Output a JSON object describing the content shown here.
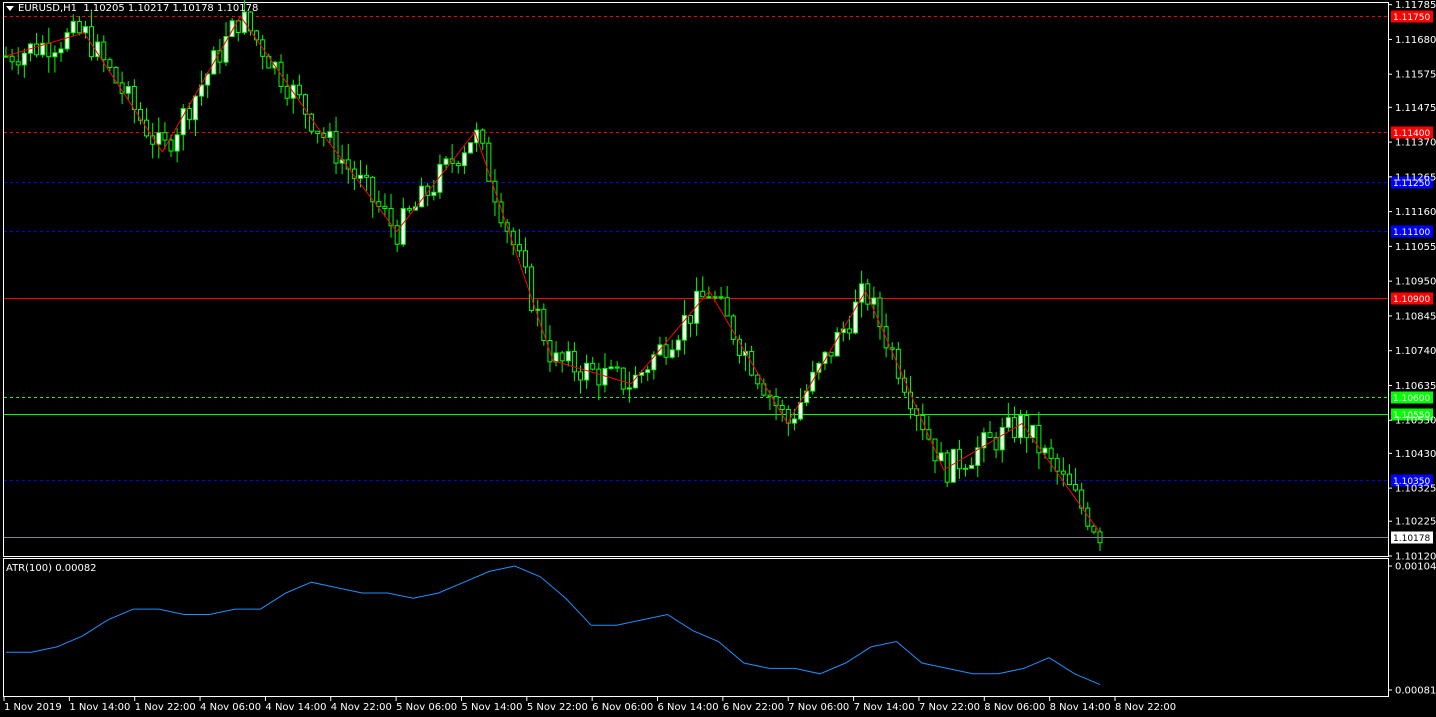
{
  "header": {
    "symbol": "EURUSD,H1",
    "ohlc": "1.10205 1.10217 1.10178 1.10178"
  },
  "atr": {
    "label": "ATR(100) 0.00082"
  },
  "price_axis": {
    "ticks": [
      "1.11785",
      "1.11680",
      "1.11575",
      "1.11475",
      "1.11370",
      "1.11265",
      "1.11160",
      "1.11055",
      "1.10950",
      "1.10845",
      "1.10740",
      "1.10635",
      "1.10530",
      "1.10430",
      "1.10325",
      "1.10225",
      "1.10120"
    ],
    "current_price": "1.10178"
  },
  "atr_axis": {
    "ticks": [
      "0.00104",
      "0.00081"
    ]
  },
  "time_axis": {
    "labels": [
      "1 Nov 2019",
      "1 Nov 14:00",
      "1 Nov 22:00",
      "4 Nov 06:00",
      "4 Nov 14:00",
      "4 Nov 22:00",
      "5 Nov 06:00",
      "5 Nov 14:00",
      "5 Nov 22:00",
      "6 Nov 06:00",
      "6 Nov 14:00",
      "6 Nov 22:00",
      "7 Nov 06:00",
      "7 Nov 14:00",
      "7 Nov 22:00",
      "8 Nov 06:00",
      "8 Nov 14:00",
      "8 Nov 22:00"
    ]
  },
  "levels": [
    {
      "price": 1.1175,
      "label": "1.11750",
      "color": "#ff0000",
      "style": "dashed"
    },
    {
      "price": 1.114,
      "label": "1.11400",
      "color": "#ff0000",
      "style": "dashed"
    },
    {
      "price": 1.1125,
      "label": "1.11250",
      "color": "#0000ff",
      "style": "dashed"
    },
    {
      "price": 1.111,
      "label": "1.11100",
      "color": "#0000ff",
      "style": "dashed"
    },
    {
      "price": 1.109,
      "label": "1.10900",
      "color": "#ff0000",
      "style": "solid"
    },
    {
      "price": 1.106,
      "label": "1.10600",
      "color": "#00ff00",
      "style": "dashed"
    },
    {
      "price": 1.1055,
      "label": "1.10550",
      "color": "#00ff00",
      "style": "solid"
    },
    {
      "price": 1.1035,
      "label": "1.10350",
      "color": "#0000ff",
      "style": "dashed"
    }
  ],
  "colors": {
    "background": "#000000",
    "bull_candle": "#ffffff",
    "bear_candle": "#000000",
    "wick": "#00ff00",
    "zigzag": "#ff0000",
    "atr_line": "#1e90ff",
    "current_price_line": "#778899"
  },
  "chart_data": {
    "type": "candlestick",
    "timeframe": "H1",
    "zigzag": [
      1.1163,
      1.117,
      1.1134,
      1.1175,
      1.1141,
      1.111,
      1.114,
      1.1071,
      1.1064,
      1.1092,
      1.1052,
      1.1092,
      1.1038,
      1.1052,
      1.1019
    ],
    "atr_series": [
      0.00088,
      0.00088,
      0.00089,
      0.00091,
      0.00094,
      0.00096,
      0.00096,
      0.00095,
      0.00095,
      0.00096,
      0.00096,
      0.00099,
      0.00101,
      0.001,
      0.00099,
      0.00099,
      0.00098,
      0.00099,
      0.00101,
      0.00103,
      0.00104,
      0.00102,
      0.00098,
      0.00093,
      0.00093,
      0.00094,
      0.00095,
      0.00092,
      0.0009,
      0.00086,
      0.00085,
      0.00085,
      0.00084,
      0.00086,
      0.00089,
      0.0009,
      0.00086,
      0.00085,
      0.00084,
      0.00084,
      0.00085,
      0.00087,
      0.00084,
      0.00082
    ],
    "price_ylim": [
      1.1012,
      1.1179
    ],
    "atr_ylim": [
      0.00081,
      0.00104
    ],
    "grid": false
  }
}
